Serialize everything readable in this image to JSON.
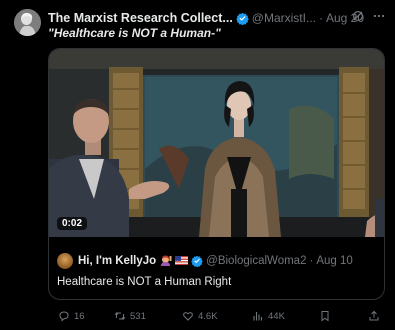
{
  "post": {
    "author_name": "The Marxist Research Collect...",
    "author_handle": "@MarxistI...",
    "date": "Aug 20",
    "text": "\"Healthcare is NOT a Human-\""
  },
  "media": {
    "duration": "0:02",
    "kind": "video"
  },
  "quoted_post": {
    "author_name": "Hi, I'm KellyJo",
    "author_handle": "@BiologicalWoma2",
    "date": "Aug 10",
    "text": "Healthcare is NOT a Human Right"
  },
  "actions": {
    "replies": "16",
    "reposts": "531",
    "likes": "4.6K",
    "views": "44K"
  },
  "colors": {
    "background": "#000000",
    "text_primary": "#e7e9ea",
    "text_secondary": "#71767b",
    "verified": "#1d9bf0",
    "border": "#2f3336"
  },
  "icons": [
    "verified-badge-icon",
    "grok-icon",
    "more-icon",
    "reply-icon",
    "repost-icon",
    "like-icon",
    "views-icon",
    "bookmark-icon",
    "share-icon"
  ],
  "separator": "·"
}
